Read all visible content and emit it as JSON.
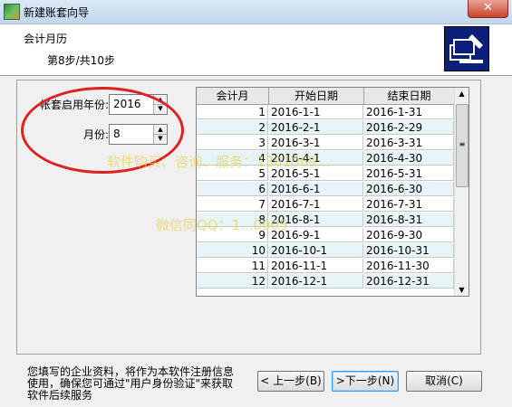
{
  "window": {
    "title": "新建账套向导",
    "close_glyph": "✕"
  },
  "header": {
    "title": "会计月历",
    "step": "第8步/共10步",
    "logo_icon": "setup-wizard-icon"
  },
  "form": {
    "year_label": "帐套启用年份:",
    "year_value": "2016",
    "month_label": "月份:",
    "month_value": "8"
  },
  "calendar_table": {
    "columns": [
      "会计月",
      "开始日期",
      "结束日期"
    ],
    "rows": [
      [
        "1",
        "2016-1-1",
        "2016-1-31"
      ],
      [
        "2",
        "2016-2-1",
        "2016-2-29"
      ],
      [
        "3",
        "2016-3-1",
        "2016-3-31"
      ],
      [
        "4",
        "2016-4-1",
        "2016-4-30"
      ],
      [
        "5",
        "2016-5-1",
        "2016-5-31"
      ],
      [
        "6",
        "2016-6-1",
        "2016-6-30"
      ],
      [
        "7",
        "2016-7-1",
        "2016-7-31"
      ],
      [
        "8",
        "2016-8-1",
        "2016-8-31"
      ],
      [
        "9",
        "2016-9-1",
        "2016-9-30"
      ],
      [
        "10",
        "2016-10-1",
        "2016-10-31"
      ],
      [
        "11",
        "2016-11-1",
        "2016-11-30"
      ],
      [
        "12",
        "2016-12-1",
        "2016-12-31"
      ]
    ]
  },
  "watermarks": {
    "line1": "软件购买、咨询、服务：1301069...",
    "line2": "微信同QQ：1...0005"
  },
  "footer": {
    "note": "您填写的企业资料，将作为本软件注册信息使用，确保您可通过\"用户身份验证\"来获取软件后续服务",
    "prev_label": "< 上一步(B)",
    "next_label": ">下一步(N)",
    "cancel_label": "取消(C)"
  },
  "colors": {
    "accent": "#3399ff",
    "highlight_ring": "#e02020",
    "alt_row": "#e7f4f7",
    "logo_bg": "#0a1f7a"
  }
}
